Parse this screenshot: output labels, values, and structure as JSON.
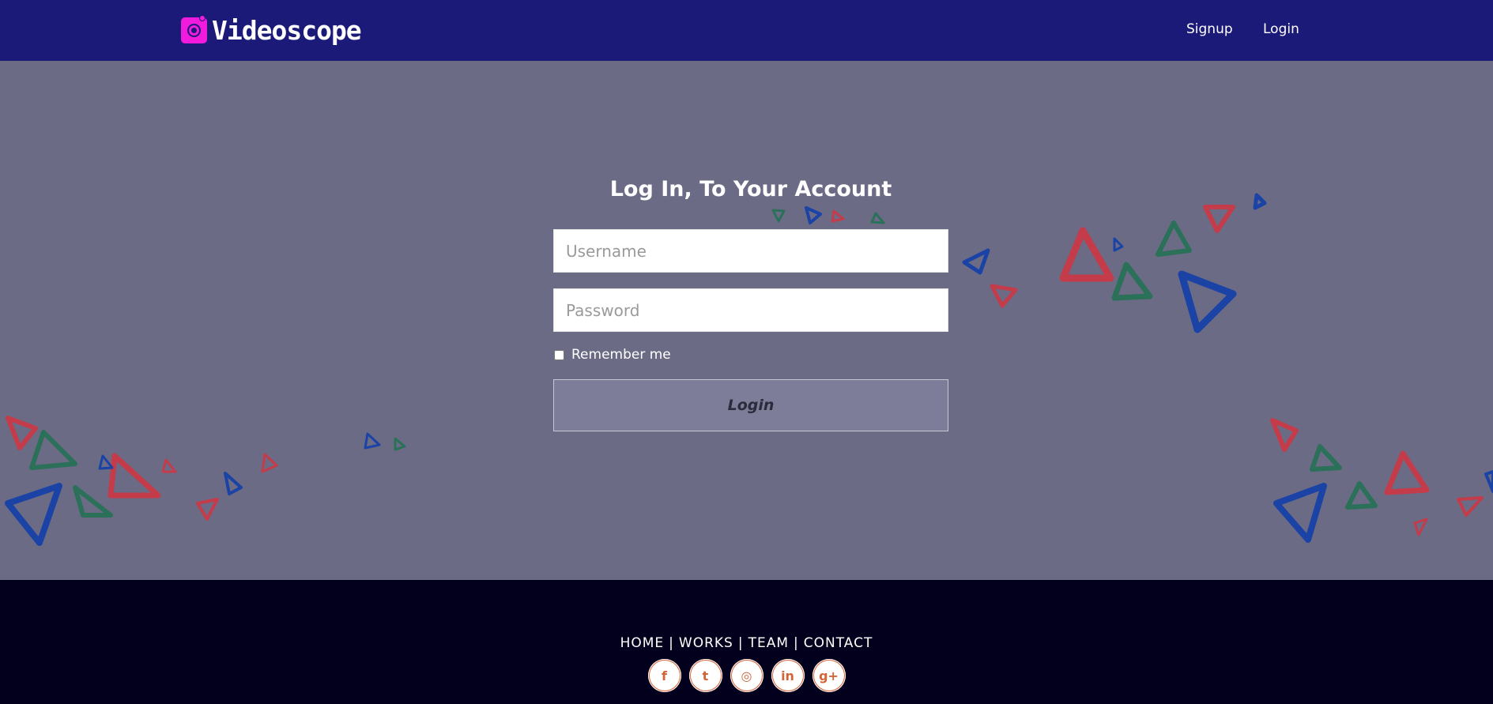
{
  "nav": {
    "brand": "Videoscope",
    "links": [
      "Signup",
      "Login"
    ]
  },
  "form": {
    "title": "Log In, To Your Account",
    "username_placeholder": "Username",
    "password_placeholder": "Password",
    "remember_label": "Remember me",
    "remember_checked": false,
    "submit_label": "Login"
  },
  "footer": {
    "links": [
      "HOME",
      "WORKS",
      "TEAM",
      "CONTACT"
    ],
    "social_icons": [
      {
        "name": "facebook-icon",
        "glyph": "f"
      },
      {
        "name": "twitter-icon",
        "glyph": "t"
      },
      {
        "name": "dribbble-icon",
        "glyph": "◎"
      },
      {
        "name": "linkedin-icon",
        "glyph": "in"
      },
      {
        "name": "google-plus-icon",
        "glyph": "g+"
      }
    ]
  },
  "colors": {
    "navbar": "#1c1a78",
    "hero": "#6b6b86",
    "footer": "#02001d",
    "brand_accent": "#f01bdc",
    "social_accent": "#d3643a"
  }
}
